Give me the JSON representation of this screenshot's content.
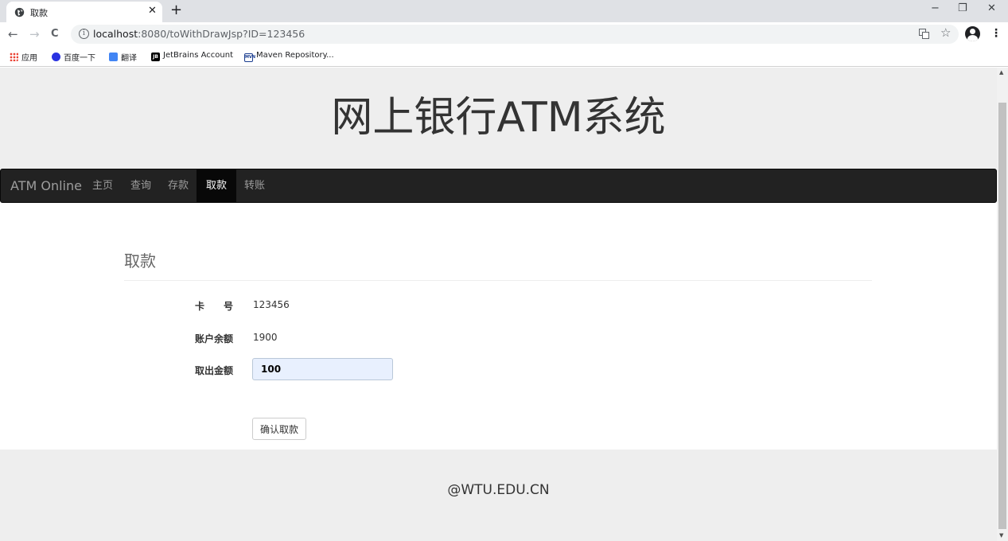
{
  "browser": {
    "tab_title": "取款",
    "tab_close": "✕",
    "new_tab": "+",
    "window_minimize": "−",
    "window_restore": "❐",
    "window_close": "✕",
    "back": "←",
    "forward": "→",
    "reload": "C",
    "url_host": "localhost",
    "url_path": ":8080/toWithDrawJsp?ID=123456",
    "translate_icon": "translate-icon",
    "star": "☆",
    "menu": "⋮",
    "bookmarks": [
      {
        "label": "应用",
        "icon": "apps-icon"
      },
      {
        "label": "百度一下",
        "icon": "baidu-icon"
      },
      {
        "label": "翻译",
        "icon": "translate-icon"
      },
      {
        "label": "JetBrains Account",
        "icon": "jetbrains-icon"
      },
      {
        "label": "Maven Repository...",
        "icon": "maven-icon"
      }
    ]
  },
  "page": {
    "site_title": "网上银行ATM系统",
    "navbar": {
      "brand": "ATM Online",
      "items": [
        {
          "label": "主页",
          "active": false
        },
        {
          "label": "查询",
          "active": false
        },
        {
          "label": "存款",
          "active": false
        },
        {
          "label": "取款",
          "active": true
        },
        {
          "label": "转账",
          "active": false
        }
      ]
    },
    "form": {
      "title": "取款",
      "card_label": "卡　　号",
      "card_value": "123456",
      "balance_label": "账户余额",
      "balance_value": "1900",
      "amount_label": "取出金额",
      "amount_value": "100",
      "submit_label": "确认取款"
    },
    "footer": "@WTU.EDU.CN"
  },
  "colors": {
    "navbar_bg": "#222222",
    "navbar_active_bg": "#080808",
    "header_bg": "#eeeeee",
    "input_bg": "#e8f0fe"
  }
}
